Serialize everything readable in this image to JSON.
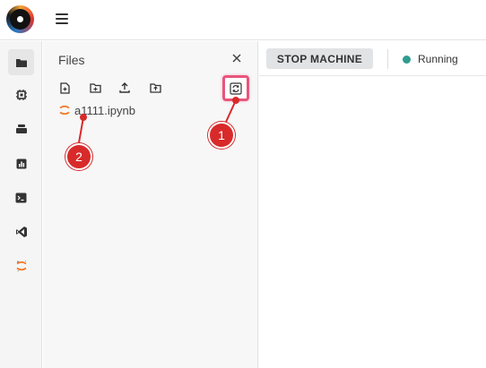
{
  "topbar": {
    "logo_icon": "circular-logo",
    "menu_icon": "hamburger-icon"
  },
  "sidebar": {
    "items": [
      {
        "name": "folder-icon",
        "active": true
      },
      {
        "name": "chip-icon",
        "active": false
      },
      {
        "name": "stack-icon",
        "active": false
      },
      {
        "name": "chart-icon",
        "active": false
      },
      {
        "name": "terminal-icon",
        "active": false
      },
      {
        "name": "vscode-icon",
        "active": false
      },
      {
        "name": "jupyter-icon",
        "active": false
      }
    ]
  },
  "files": {
    "title": "Files",
    "toolbar": [
      "new-file-icon",
      "new-folder-icon",
      "upload-icon",
      "new-folder-plus-icon",
      "refresh-icon"
    ],
    "items": [
      {
        "name": "a1111.ipynb",
        "icon": "jupyter-icon"
      }
    ]
  },
  "machine": {
    "stop_label": "STOP MACHINE",
    "status": "Running",
    "status_color": "#2e9c8f"
  },
  "annotations": [
    {
      "label": "1"
    },
    {
      "label": "2"
    }
  ],
  "colors": {
    "annotation_red": "#d82a2a",
    "highlight_pink": "#e8557b",
    "jupyter_orange": "#f37726"
  }
}
